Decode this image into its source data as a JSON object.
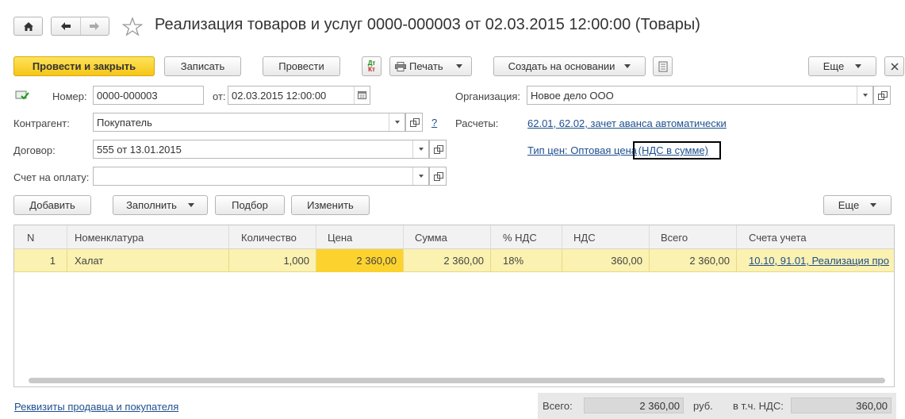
{
  "window": {
    "title": "Реализация товаров и услуг 0000-000003 от 02.03.2015 12:00:00 (Товары)"
  },
  "toolbar": {
    "post_and_close": "Провести и закрыть",
    "save": "Записать",
    "post": "Провести",
    "dtkt_top": "Дт",
    "dtkt_bottom": "Кт",
    "print": "Печать",
    "create_based_on": "Создать на основании",
    "more": "Еще"
  },
  "form": {
    "number_label": "Номер:",
    "number_value": "0000-000003",
    "date_label": "от:",
    "date_value": "02.03.2015 12:00:00",
    "org_label": "Организация:",
    "org_value": "Новое дело ООО",
    "counterparty_label": "Контрагент:",
    "counterparty_value": "Покупатель",
    "help": "?",
    "settlements_label": "Расчеты:",
    "settlements_link": "62.01, 62.02, зачет аванса автоматически",
    "contract_label": "Договор:",
    "contract_value": "555 от 13.01.2015",
    "price_type_link_a": "Тип цен: Оптовая цена",
    "price_type_link_b": "(НДС в сумме)",
    "invoice_label": "Счет на оплату:",
    "invoice_value": ""
  },
  "table_toolbar": {
    "add": "Добавить",
    "fill": "Заполнить",
    "select": "Подбор",
    "change": "Изменить",
    "more": "Еще"
  },
  "table": {
    "columns": [
      "N",
      "Номенклатура",
      "Количество",
      "Цена",
      "Сумма",
      "% НДС",
      "НДС",
      "Всего",
      "Счета учета"
    ],
    "rows": [
      {
        "n": "1",
        "item": "Халат",
        "qty": "1,000",
        "price": "2 360,00",
        "sum": "2 360,00",
        "vat_rate": "18%",
        "vat": "360,00",
        "total": "2 360,00",
        "accounts": "10.10, 91.01, Реализация про"
      }
    ]
  },
  "footer": {
    "requisites_link": "Реквизиты продавца и покупателя",
    "total_label": "Всего:",
    "total_value": "2 360,00",
    "currency": "руб.",
    "vat_label": "в т.ч. НДС:",
    "vat_value": "360,00"
  },
  "colors": {
    "primary_button": "#f6c618",
    "selected_row": "#fbf1b0",
    "active_cell": "#fcd22e",
    "link": "#1f4f8f"
  }
}
